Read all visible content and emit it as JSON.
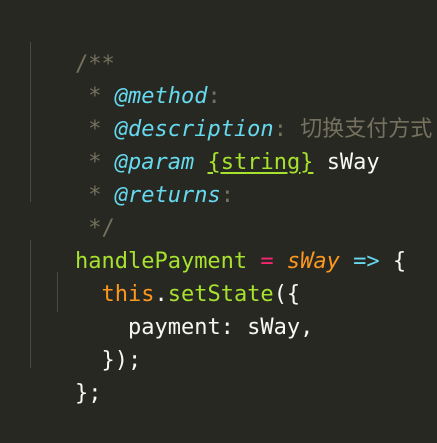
{
  "code": {
    "language": "javascript",
    "lines": [
      {
        "open": "/**"
      },
      {
        "star": "*",
        "tag": "@method",
        "colon": ":"
      },
      {
        "star": "*",
        "tag": "@description",
        "colon": ":",
        "desc": "切换支付方式"
      },
      {
        "star": "*",
        "tag": "@param",
        "type": "{string}",
        "name": "sWay"
      },
      {
        "star": "*",
        "tag": "@returns",
        "colon": ":"
      },
      {
        "close": "*/"
      },
      {
        "fn": "handlePayment",
        "assign": "=",
        "param": "sWay",
        "arrow": "=>",
        "brace": "{"
      },
      {
        "this": "this",
        "dot": ".",
        "method": "setState",
        "paren": "({"
      },
      {
        "text": "payment: sWay,"
      },
      {
        "text": "});"
      },
      {
        "text": "};"
      }
    ]
  },
  "colors": {
    "background": "#272822",
    "foreground": "#f8f8f2",
    "comment": "#75715e",
    "tag": "#66d9ef",
    "function": "#a6e22e",
    "keyword": "#f92672",
    "parameter": "#fd971f"
  }
}
